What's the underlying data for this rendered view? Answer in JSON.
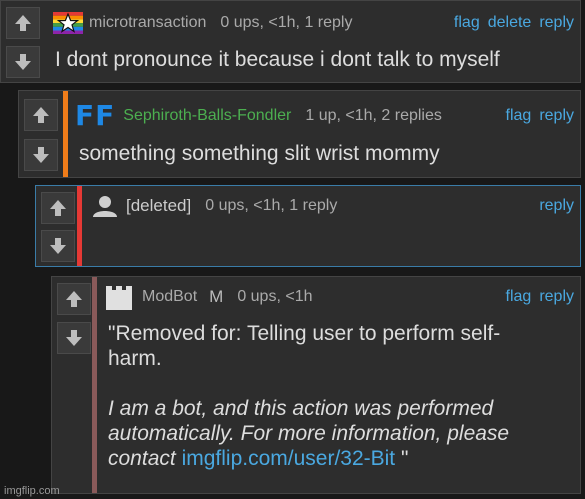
{
  "comments": [
    {
      "username": "microtransaction",
      "meta": "0 ups, <1h, 1 reply",
      "actions": [
        "flag",
        "delete",
        "reply"
      ],
      "text": "I dont pronounce it because i dont talk to myself",
      "avatar_icon": "star-flag-icon"
    },
    {
      "username": "Sephiroth-Balls-Fondler",
      "username_color": "#4caf50",
      "meta": "1 up, <1h, 2 replies",
      "actions": [
        "flag",
        "reply"
      ],
      "text": "something something slit wrist mommy",
      "bar_color": "#f07d1a",
      "avatar_icon": "ff-logo-icon",
      "avatar_text": "FF"
    },
    {
      "username": "[deleted]",
      "meta": "0 ups, <1h, 1 reply",
      "actions": [
        "reply"
      ],
      "text": "",
      "bar_color": "#e53935",
      "avatar_icon": "user-silhouette-icon"
    },
    {
      "username": "ModBot",
      "mod_badge": "M",
      "meta": "0 ups, <1h",
      "actions": [
        "flag",
        "reply"
      ],
      "text_line1": "\"Removed for: Telling user to perform self-",
      "text_line2": "harm.",
      "italic_line1": "I am a bot, and this action was performed",
      "italic_line2": "automatically. For more information, please",
      "italic_line3": "contact",
      "link": "imgflip.com/user/32-Bit",
      "closing_quote": "\"",
      "bar_color": "#8a5a5a",
      "avatar_icon": "castle-tower-icon"
    }
  ],
  "watermark": "imgflip.com",
  "colors": {
    "link": "#4aa8e0",
    "bg": "#2d2d2d"
  }
}
